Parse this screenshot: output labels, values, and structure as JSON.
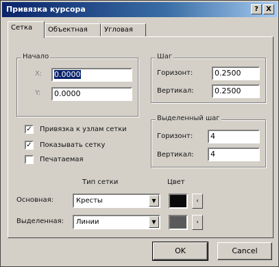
{
  "window": {
    "title": "Привязка курсора",
    "help_label": "?",
    "close_label": "X"
  },
  "tabs": [
    {
      "label": "Сетка"
    },
    {
      "label": "Объектная"
    },
    {
      "label": "Угловая"
    }
  ],
  "origin": {
    "group_label": "Начало",
    "x_label": "X:",
    "x_value": "0.0000",
    "y_label": "Y:",
    "y_value": "0.0000"
  },
  "step": {
    "group_label": "Шаг",
    "horiz_label": "Горизонт:",
    "horiz_value": "0.2500",
    "vert_label": "Вертикал:",
    "vert_value": "0.2500"
  },
  "options": [
    {
      "label": "Привязка к узлам сетки",
      "checked": "✓"
    },
    {
      "label": "Показывать сетку",
      "checked": "✓"
    },
    {
      "label": "Печатаемая",
      "checked": ""
    }
  ],
  "major_step": {
    "group_label": "Выделенный шаг",
    "horiz_label": "Горизонт:",
    "horiz_value": "4",
    "vert_label": "Вертикал:",
    "vert_value": "4"
  },
  "grid_type": {
    "type_header": "Тип сетки",
    "color_header": "Цвет",
    "main_label": "Основная:",
    "main_value": "Кресты",
    "major_label": "Выделенная:",
    "major_value": "Линии",
    "arrow": "▼",
    "more": "‹",
    "main_color": "#0a0a0a",
    "major_color": "#5a5a5a"
  },
  "buttons": {
    "ok": "OK",
    "cancel": "Cancel"
  }
}
